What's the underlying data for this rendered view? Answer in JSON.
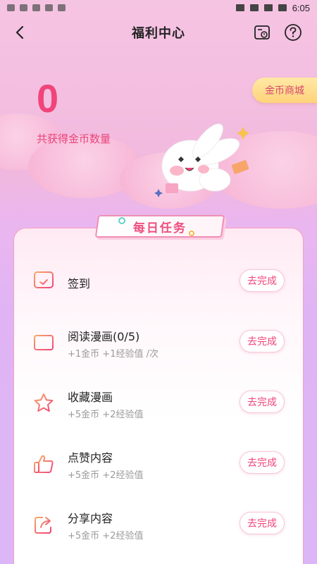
{
  "status_bar": {
    "time": "6:05"
  },
  "header": {
    "title": "福利中心"
  },
  "hero": {
    "coin_count": "0",
    "coin_label": "共获得金币数量",
    "mall_button": "金币商城"
  },
  "tasks_section": {
    "tab_label": "每日任务",
    "action_label": "去完成",
    "items": [
      {
        "title": "签到",
        "reward": "",
        "icon": "calendar-icon"
      },
      {
        "title": "阅读漫画(0/5)",
        "reward": "+1金币 +1经验值 /次",
        "icon": "book-icon"
      },
      {
        "title": "收藏漫画",
        "reward": "+5金币 +2经验值",
        "icon": "star-icon"
      },
      {
        "title": "点赞内容",
        "reward": "+5金币 +2经验值",
        "icon": "thumbs-up-icon"
      },
      {
        "title": "分享内容",
        "reward": "+5金币 +2经验值",
        "icon": "share-icon"
      }
    ]
  },
  "colors": {
    "accent": "#f0447a",
    "tab_border": "#f08fb5",
    "mall_button_bg": "#ffd27a"
  }
}
